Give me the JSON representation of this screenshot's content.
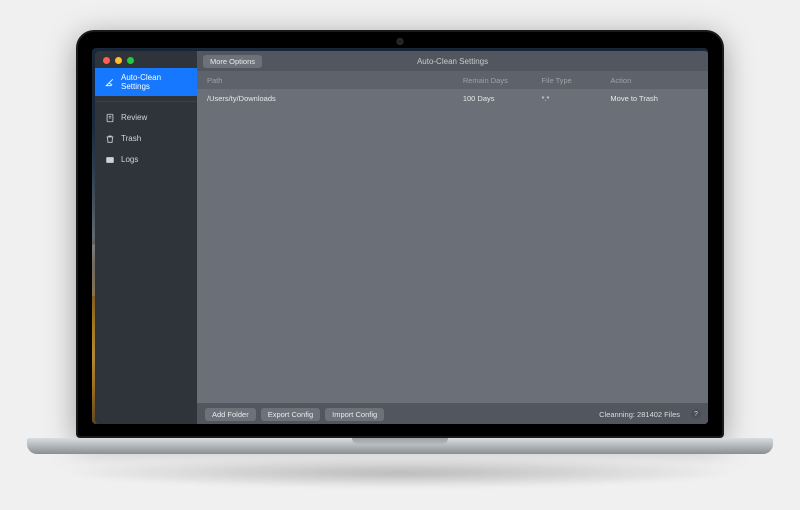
{
  "sidebar": {
    "items": [
      {
        "label": "Auto-Clean Settings",
        "icon": "broom"
      },
      {
        "label": "Review",
        "icon": "document"
      },
      {
        "label": "Trash",
        "icon": "trash"
      },
      {
        "label": "Logs",
        "icon": "terminal"
      }
    ],
    "selected_index": 0
  },
  "topbar": {
    "more_options": "More Options",
    "title": "Auto-Clean Settings"
  },
  "table": {
    "headers": {
      "path": "Path",
      "remain_days": "Remain Days",
      "file_type": "File Type",
      "action": "Action"
    },
    "rows": [
      {
        "path": "/Users/ty/Downloads",
        "remain_days": "100 Days",
        "file_type": "*.*",
        "action": "Move to Trash"
      }
    ]
  },
  "bottombar": {
    "add_folder": "Add Folder",
    "export_config": "Export Config",
    "import_config": "Import Config",
    "status": "Cleanning: 281402 Files"
  }
}
